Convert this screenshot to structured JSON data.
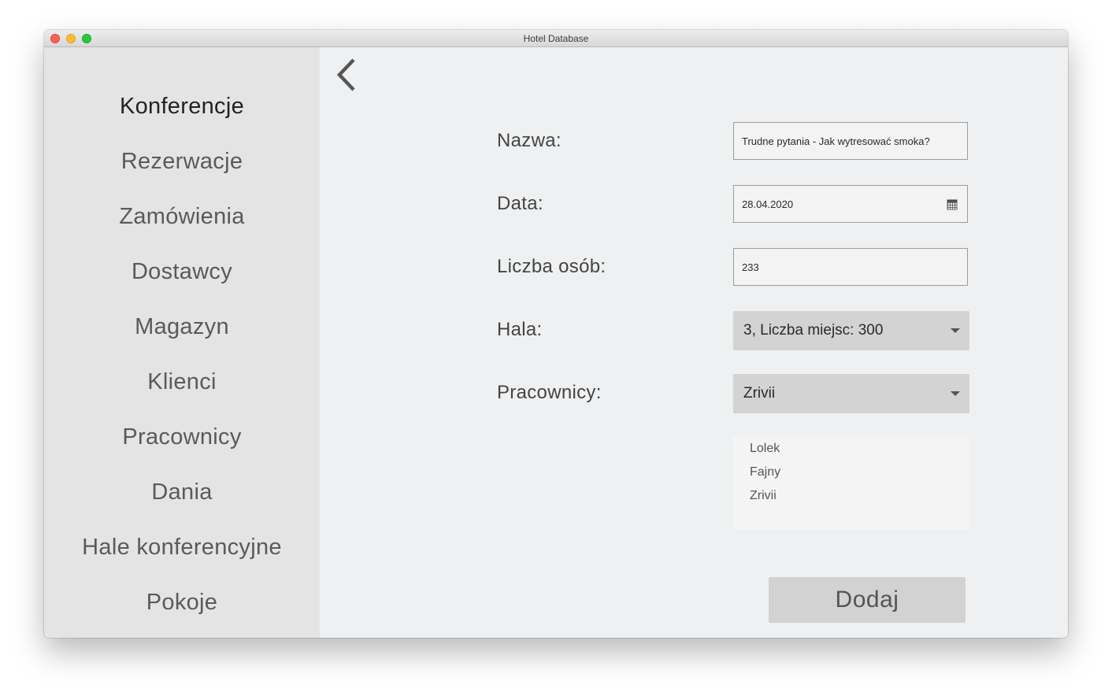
{
  "window": {
    "title": "Hotel Database"
  },
  "sidebar": {
    "items": [
      {
        "label": "Konferencje",
        "active": true
      },
      {
        "label": "Rezerwacje"
      },
      {
        "label": "Zamówienia"
      },
      {
        "label": "Dostawcy"
      },
      {
        "label": "Magazyn"
      },
      {
        "label": "Klienci"
      },
      {
        "label": "Pracownicy"
      },
      {
        "label": "Dania"
      },
      {
        "label": "Hale konferencyjne"
      },
      {
        "label": "Pokoje"
      }
    ]
  },
  "form": {
    "nazwa_label": "Nazwa:",
    "nazwa_value": "Trudne pytania - Jak wytresować smoka?",
    "data_label": "Data:",
    "data_value": "28.04.2020",
    "liczba_label": "Liczba osób:",
    "liczba_value": "233",
    "hala_label": "Hala:",
    "hala_value": "3, Liczba miejsc: 300",
    "pracownicy_label": "Pracownicy:",
    "pracownicy_value": "Zrivii",
    "pracownicy_list": [
      "Lolek",
      "Fajny",
      "Zrivii"
    ],
    "submit_label": "Dodaj"
  },
  "icons": {
    "back": "chevron-left-icon",
    "calendar": "calendar-icon",
    "dropdown": "chevron-down-icon"
  }
}
